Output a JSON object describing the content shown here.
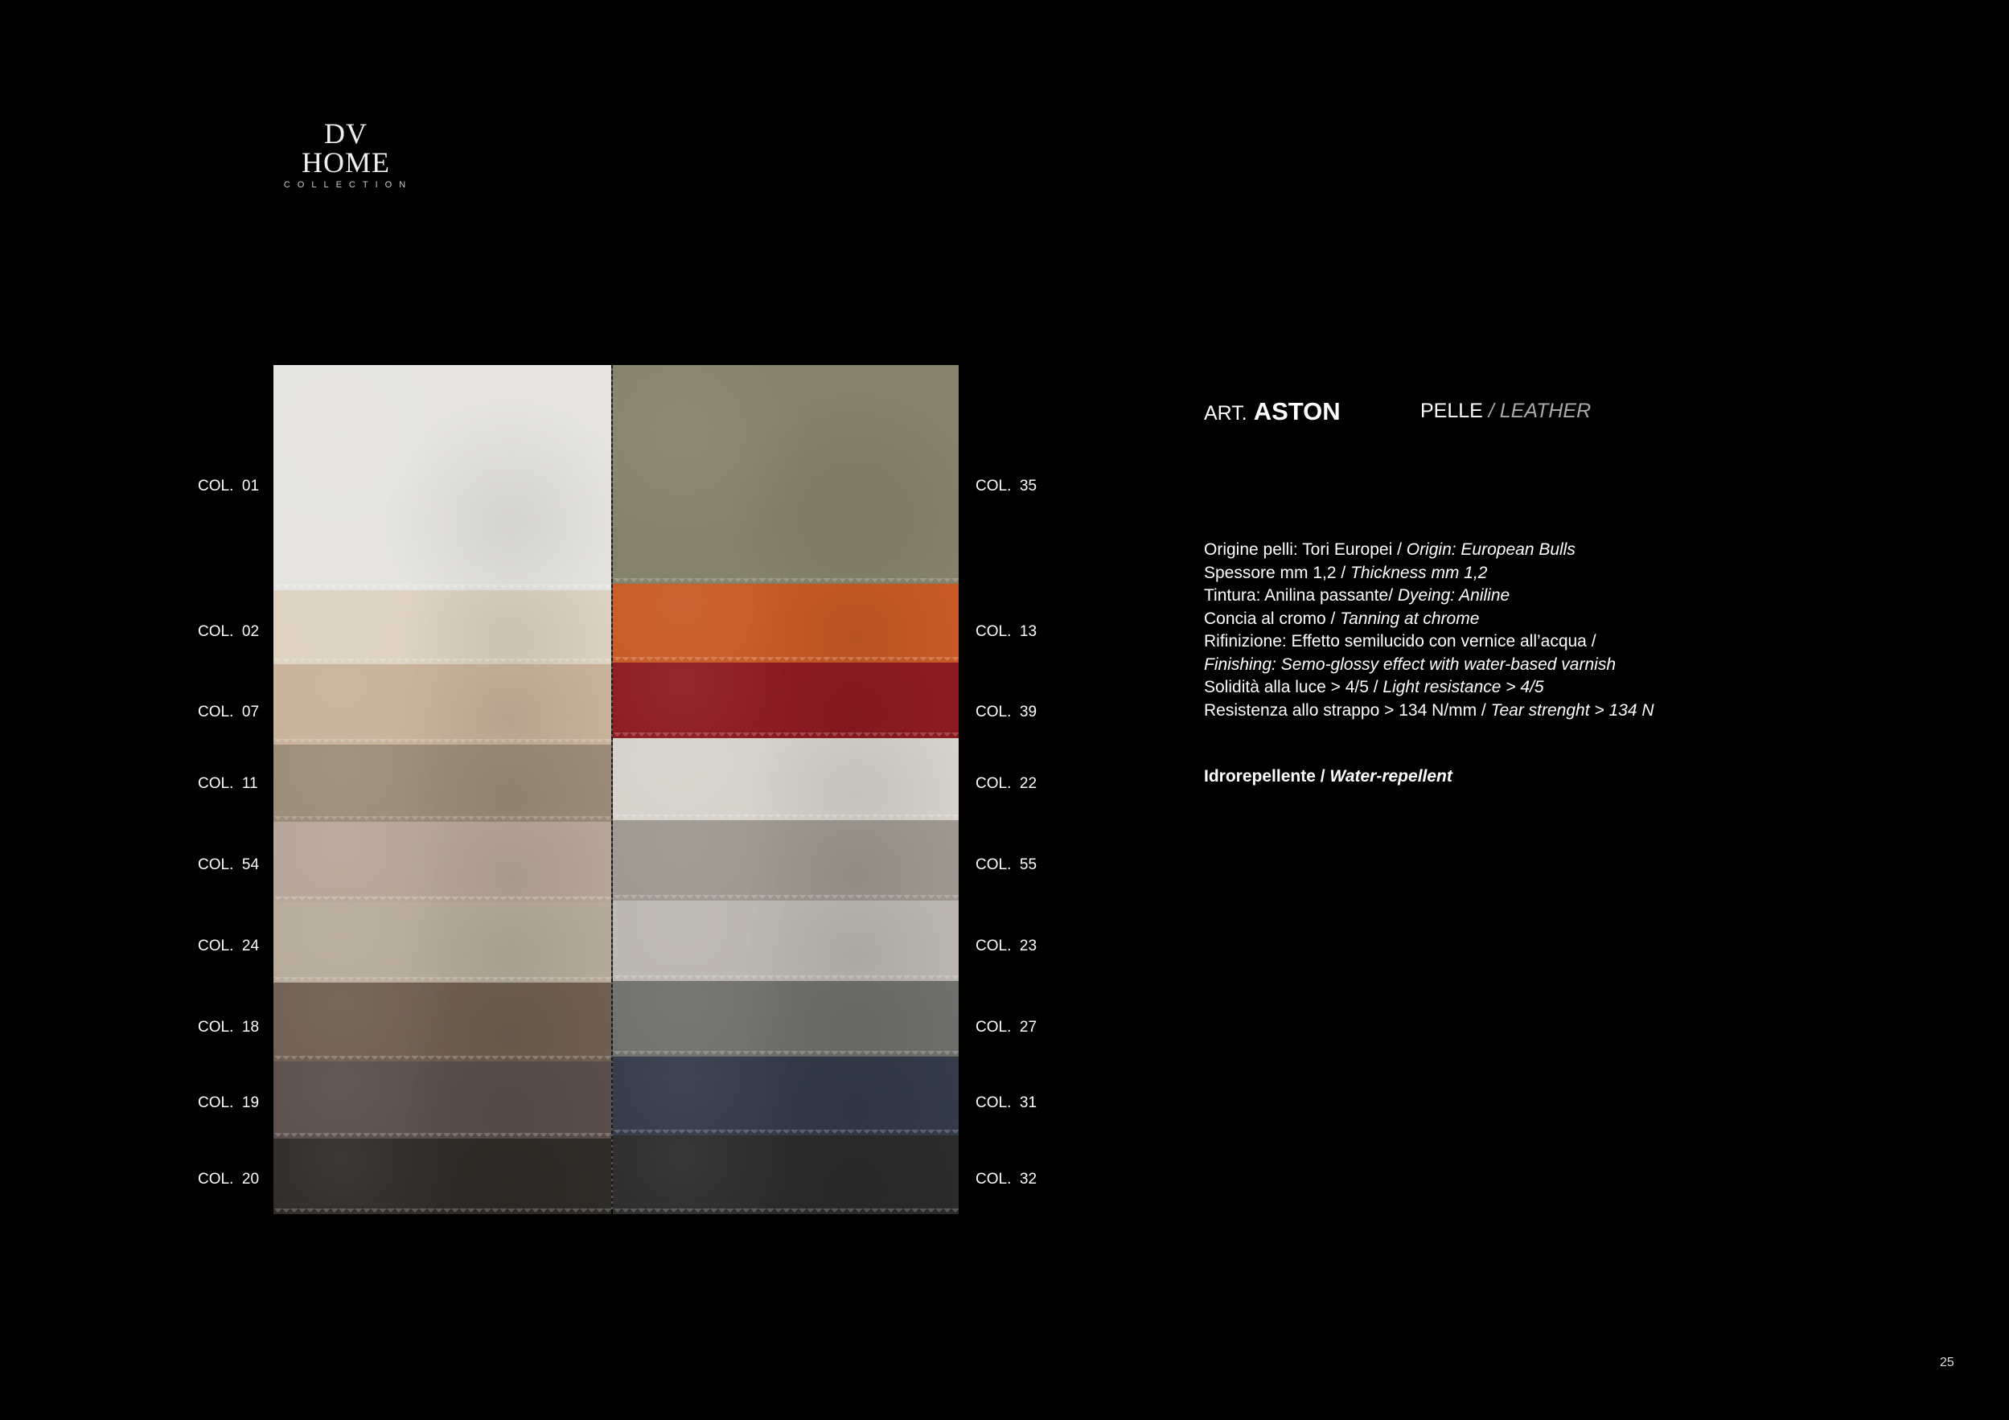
{
  "logo": {
    "main": "DV HOME",
    "sub": "COLLECTION"
  },
  "article": {
    "prefix": "ART.",
    "name": "ASTON",
    "material_it": "PELLE",
    "separator": " / ",
    "material_en": "LEATHER"
  },
  "specs": [
    {
      "it": "Origine pelli: Tori Europei / ",
      "en": "Origin: European Bulls"
    },
    {
      "it": "Spessore mm 1,2 / ",
      "en": "Thickness mm 1,2"
    },
    {
      "it": "Tintura: Anilina passante/ ",
      "en": "Dyeing: Aniline"
    },
    {
      "it": "Concia al cromo / ",
      "en": "Tanning at chrome"
    },
    {
      "it": "Rifinizione: Effetto semilucido con vernice all’acqua /",
      "en": ""
    },
    {
      "it": "",
      "en": "Finishing: Semo-glossy effect with water-based varnish"
    },
    {
      "it": "Solidità alla luce > 4/5 / ",
      "en": "Light resistance > 4/5"
    },
    {
      "it": "Resistenza allo strappo > 134 N/mm / ",
      "en": "Tear strenght > 134 N"
    }
  ],
  "feature": {
    "it": "Idrorepellente / ",
    "en": "Water-repellent"
  },
  "swatches_left": [
    {
      "label": "COL.  01",
      "color": "#e6e5e2"
    },
    {
      "label": "COL.  02",
      "color": "#ddd2c1"
    },
    {
      "label": "COL.  07",
      "color": "#c8b29a"
    },
    {
      "label": "COL.  11",
      "color": "#9a8c78"
    },
    {
      "label": "COL.  54",
      "color": "#b7a69a"
    },
    {
      "label": "COL.  24",
      "color": "#b6ab9b"
    },
    {
      "label": "COL.  18",
      "color": "#6f5f52"
    },
    {
      "label": "COL.  19",
      "color": "#5a4e4a"
    },
    {
      "label": "COL.  20",
      "color": "#2f2c28"
    }
  ],
  "swatches_right": [
    {
      "label": "COL.  35",
      "color": "#86836c"
    },
    {
      "label": "COL.  13",
      "color": "#c85a25"
    },
    {
      "label": "COL.  39",
      "color": "#8c1a20"
    },
    {
      "label": "COL.  22",
      "color": "#d5d2ca"
    },
    {
      "label": "COL.  55",
      "color": "#9e988f"
    },
    {
      "label": "COL.  23",
      "color": "#bbb6b0"
    },
    {
      "label": "COL.  27",
      "color": "#6f706c"
    },
    {
      "label": "COL.  31",
      "color": "#333a48"
    },
    {
      "label": "COL.  32",
      "color": "#2b2b2b"
    }
  ],
  "page_number": "25"
}
